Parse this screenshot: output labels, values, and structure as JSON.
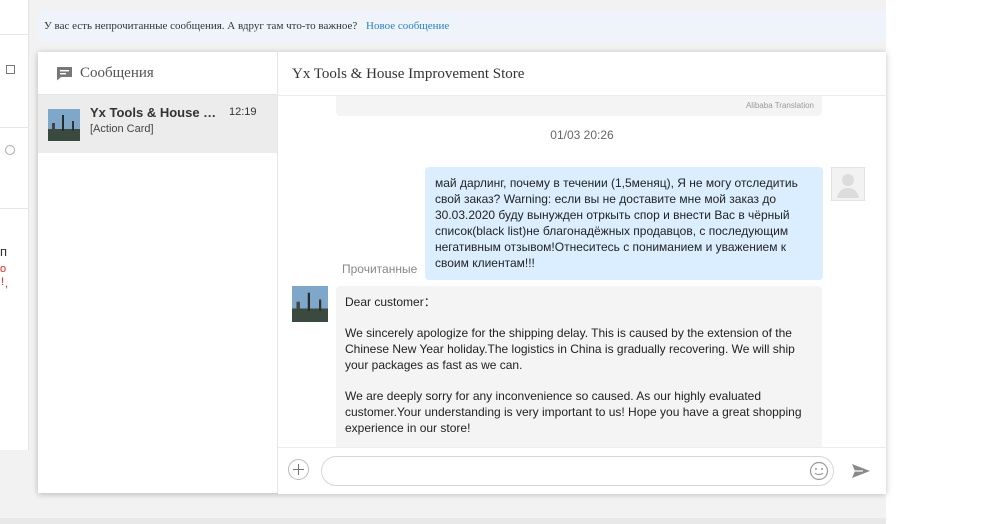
{
  "notice": {
    "text": "У вас есть непрочитанные сообщения. А вдруг там что-то важное?",
    "link": "Новое сообщение"
  },
  "background": {
    "fragments": [
      "п",
      "о",
      "!",
      ","
    ]
  },
  "sidebar": {
    "title": "Сообщения",
    "conversations": [
      {
        "name": "Yx Tools & House Improvement Store",
        "time": "12:19",
        "preview": "[Action Card]"
      }
    ]
  },
  "chat": {
    "title": "Yx Tools & House Improvement Store",
    "previous_translation_label": "Alibaba Translation",
    "date_separator": "01/03 20:26",
    "outgoing_message": "май дарлинг, почему в течении (1,5меняц), Я не могу отследитиь свой заказ? Warning: если вы не доставите мне мой заказ до 30.03.2020 буду вынужден отркыть спор и внести Вас в чёрный список(black list)не благонадёжных продавцов, с последующим негативным отзывом!Отнеситесь с пониманием и уважением к своим клиентам!!!",
    "read_status": "Прочитанные",
    "incoming_paragraphs": [
      "Dear customer：",
      " We sincerely apologize for the shipping delay. This is caused by the extension of the Chinese New Year holiday.The logistics in China is gradually recovering. We will ship your packages as fast as we can.",
      " We are deeply sorry for any inconvenience so caused. As our highly evaluated customer.Your understanding is very important to us! Hope you have a great shopping experience in our store!"
    ]
  },
  "composer": {
    "placeholder": "",
    "icons": [
      "plus-icon",
      "emoji-icon",
      "send-icon"
    ]
  },
  "colors": {
    "outgoing_bubble": "#dbeeff",
    "incoming_bubble": "#f4f4f4",
    "link": "#2a7fc9",
    "selected_conversation": "#ececec"
  }
}
